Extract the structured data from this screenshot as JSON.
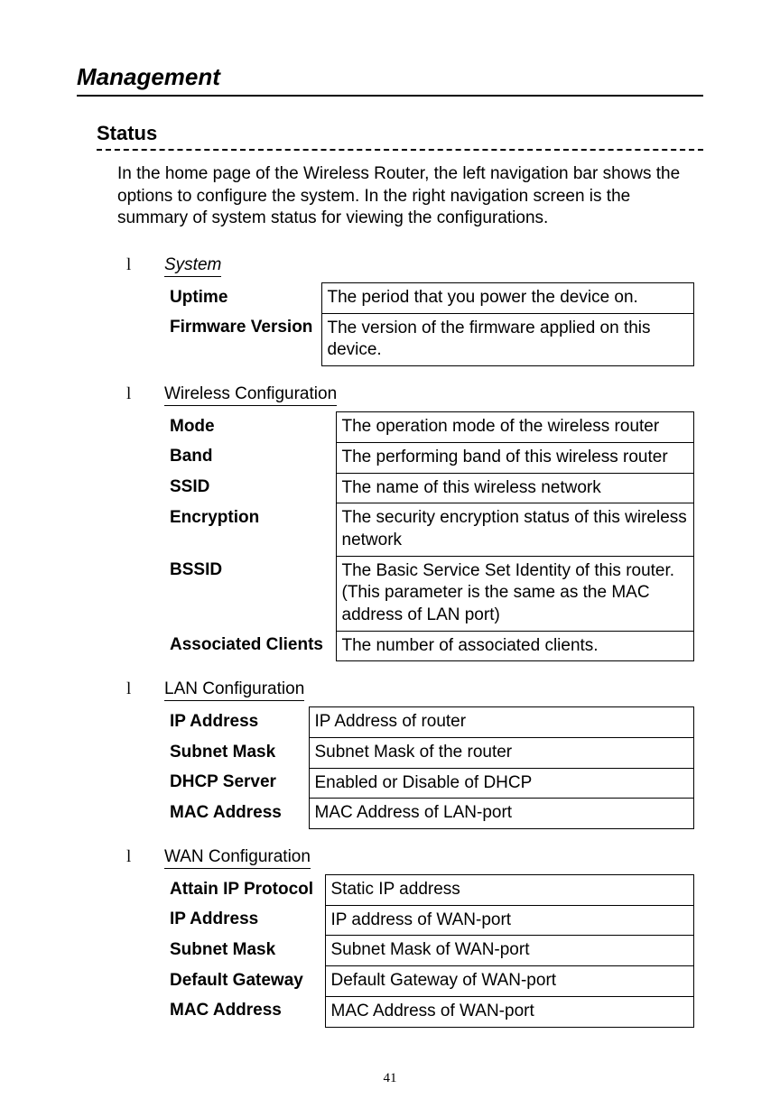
{
  "pageTitle": "Management",
  "statusTitle": "Status",
  "intro": "In the home page of the Wireless Router, the left navigation bar shows the options to configure the system. In the right navigation screen is the summary of system status for viewing the configurations.",
  "pageNumber": "41",
  "bullet": "l",
  "sections": [
    {
      "title": "System",
      "italic": true,
      "tableClass": "table-system",
      "rows": [
        {
          "key": "Uptime",
          "val": "The period that you power the device on."
        },
        {
          "key": "Firmware Version",
          "val": "The version of the firmware applied on this device."
        }
      ]
    },
    {
      "title": "Wireless Configuration",
      "italic": false,
      "tableClass": "table-wireless",
      "rows": [
        {
          "key": "Mode",
          "val": "The operation mode of the wireless router"
        },
        {
          "key": "Band",
          "val": "The performing band of this wireless router"
        },
        {
          "key": "SSID",
          "val": "The name of this wireless network"
        },
        {
          "key": "Encryption",
          "val": "The security encryption status of this wireless network"
        },
        {
          "key": "BSSID",
          "val": "The Basic Service Set Identity of this router.(This parameter is the same as the MAC address of LAN port)"
        },
        {
          "key": "Associated Clients",
          "val": "The number of associated clients."
        }
      ]
    },
    {
      "title": "LAN Configuration",
      "italic": false,
      "tableClass": "table-lan",
      "rows": [
        {
          "key": "IP Address",
          "val": "IP Address of router"
        },
        {
          "key": "Subnet Mask",
          "val": "Subnet Mask of the router"
        },
        {
          "key": "DHCP Server",
          "val": "Enabled or Disable of DHCP"
        },
        {
          "key": "MAC Address",
          "val": "MAC Address of LAN-port"
        }
      ]
    },
    {
      "title": "WAN Configuration",
      "italic": false,
      "tableClass": "table-wan",
      "rows": [
        {
          "key": "Attain IP Protocol",
          "val": "Static IP address"
        },
        {
          "key": "IP Address",
          "val": "IP address of WAN-port"
        },
        {
          "key": "Subnet Mask",
          "val": "Subnet Mask of WAN-port"
        },
        {
          "key": "Default Gateway",
          "val": "Default Gateway of WAN-port"
        },
        {
          "key": "MAC Address",
          "val": "MAC Address of WAN-port"
        }
      ]
    }
  ]
}
